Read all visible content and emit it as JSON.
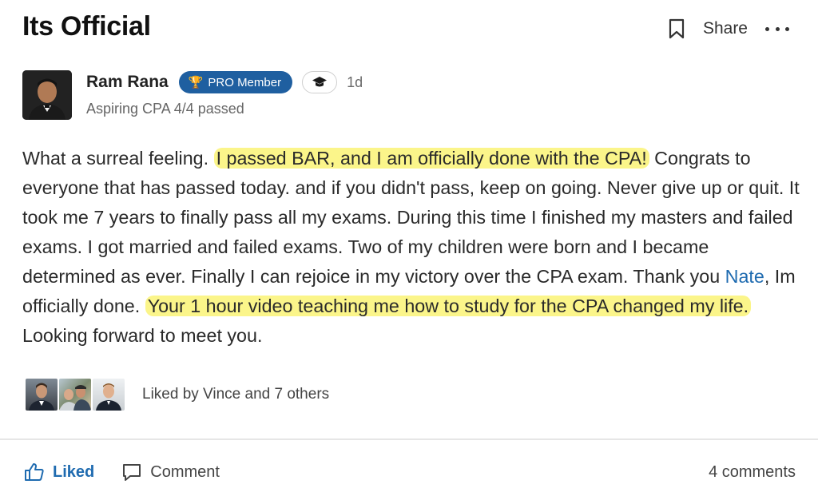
{
  "post": {
    "title": "Its Official",
    "share_label": "Share"
  },
  "author": {
    "name": "Ram Rana",
    "badge": "PRO Member",
    "time": "1d",
    "subtitle": "Aspiring CPA 4/4 passed"
  },
  "body": {
    "p1": "What a surreal feeling. ",
    "h1": "I passed BAR, and I am officially done with the CPA!",
    "p2": " Congrats to everyone that has passed today. and if you didn't pass, keep on going. Never give up or quit. It took me 7 years to finally pass all my exams. During this time I finished my masters and failed exams. I got married and failed exams. Two of my children were born and I became determined as ever. Finally I can rejoice in my victory over the CPA exam. Thank you ",
    "mention": "Nate",
    "p3": ", Im officially done. ",
    "h2": "Your 1 hour video teaching me how to study for the CPA changed my life.",
    "p4": " Looking forward to meet you."
  },
  "likes": {
    "text": "Liked by Vince and 7 others"
  },
  "footer": {
    "liked_label": "Liked",
    "comment_label": "Comment",
    "comments_count": "4 comments"
  },
  "colors": {
    "accent": "#1f6bb0",
    "badge_bg": "#1f5fa0",
    "highlight": "#fbf58a"
  }
}
